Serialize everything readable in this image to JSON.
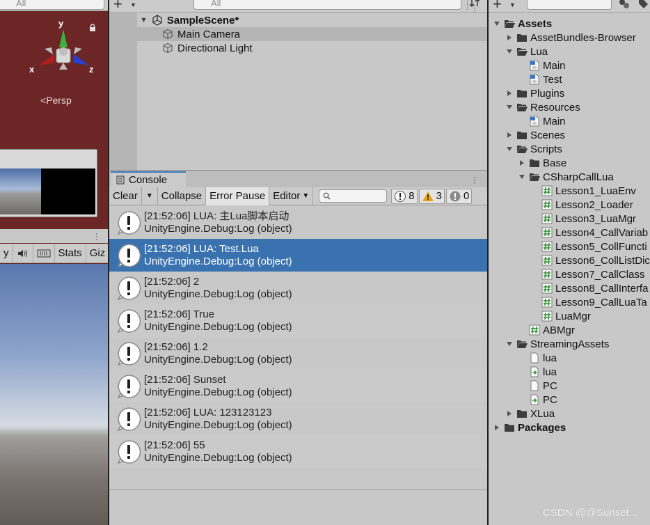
{
  "scene": {
    "search_placeholder": "All",
    "gizmo": {
      "y": "y",
      "x": "x",
      "z": "z"
    },
    "persp_label": "Persp",
    "toolbar": {
      "stats": "Stats",
      "gizmos_truncated": "Giz",
      "left_truncated": "y"
    }
  },
  "hierarchy": {
    "search_placeholder": "All",
    "scene_name": "SampleScene*",
    "items": [
      {
        "label": "Main Camera"
      },
      {
        "label": "Directional Light"
      }
    ]
  },
  "console": {
    "tab_label": "Console",
    "toolbar": {
      "clear": "Clear",
      "collapse": "Collapse",
      "error_pause": "Error Pause",
      "editor": "Editor",
      "log_count": "8",
      "warning_count": "3",
      "error_count": "0"
    },
    "logs": [
      {
        "line1": "[21:52:06] LUA: 主Lua脚本启动",
        "line2": "UnityEngine.Debug:Log (object)",
        "selected": false
      },
      {
        "line1": "[21:52:06] LUA: Test.Lua",
        "line2": "UnityEngine.Debug:Log (object)",
        "selected": true
      },
      {
        "line1": "[21:52:06] 2",
        "line2": "UnityEngine.Debug:Log (object)",
        "selected": false
      },
      {
        "line1": "[21:52:06] True",
        "line2": "UnityEngine.Debug:Log (object)",
        "selected": false
      },
      {
        "line1": "[21:52:06] 1.2",
        "line2": "UnityEngine.Debug:Log (object)",
        "selected": false
      },
      {
        "line1": "[21:52:06] Sunset",
        "line2": "UnityEngine.Debug:Log (object)",
        "selected": false
      },
      {
        "line1": "[21:52:06] LUA: 123123123",
        "line2": "UnityEngine.Debug:Log (object)",
        "selected": false
      },
      {
        "line1": "[21:52:06] 55",
        "line2": "UnityEngine.Debug:Log (object)",
        "selected": false
      }
    ]
  },
  "project": {
    "tree": [
      {
        "label": "Assets",
        "bold": true
      },
      {
        "label": "AssetBundles-Browser"
      },
      {
        "label": "Lua"
      },
      {
        "label": "Main"
      },
      {
        "label": "Test"
      },
      {
        "label": "Plugins"
      },
      {
        "label": "Resources"
      },
      {
        "label": "Main"
      },
      {
        "label": "Scenes"
      },
      {
        "label": "Scripts"
      },
      {
        "label": "Base"
      },
      {
        "label": "CSharpCallLua"
      },
      {
        "label": "Lesson1_LuaEnv"
      },
      {
        "label": "Lesson2_Loader"
      },
      {
        "label": "Lesson3_LuaMgr"
      },
      {
        "label": "Lesson4_CallVariab"
      },
      {
        "label": "Lesson5_CollFuncti"
      },
      {
        "label": "Lesson6_CollListDic"
      },
      {
        "label": "Lesson7_CallClass"
      },
      {
        "label": "Lesson8_CallInterfa"
      },
      {
        "label": "Lesson9_CallLuaTa"
      },
      {
        "label": "LuaMgr"
      },
      {
        "label": "ABMgr"
      },
      {
        "label": "StreamingAssets"
      },
      {
        "label": "lua"
      },
      {
        "label": "lua"
      },
      {
        "label": "PC"
      },
      {
        "label": "PC"
      },
      {
        "label": "XLua"
      },
      {
        "label": "Packages",
        "bold": true
      }
    ]
  },
  "watermark": "CSDN @@Sunset..."
}
